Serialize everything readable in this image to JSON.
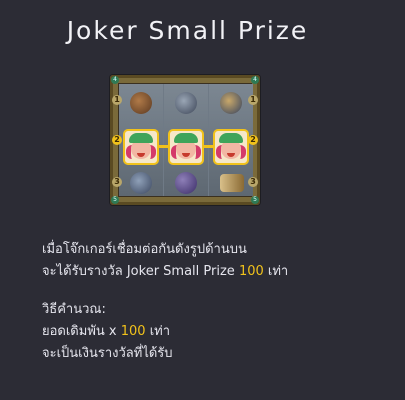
{
  "title": "Joker Small Prize",
  "description": {
    "line1": "เมื่อโจ๊กเกอร์เชื่อมต่อกันดังรูปด้านบน",
    "line2_prefix": "จะได้รับรางวัล Joker Small Prize ",
    "line2_value": "100",
    "line2_suffix": " เท่า"
  },
  "calculation": {
    "heading": "วิธีคำนวณ:",
    "line1_prefix": "ยอดเดิมพัน x ",
    "line1_value": "100",
    "line1_suffix": " เท่า",
    "line2": "จะเป็นเงินรางวัลที่ได้รับ"
  },
  "illustration": {
    "payline_badge_left": "2",
    "payline_badge_right": "2",
    "row1_badge_left": "1",
    "row1_badge_right": "1",
    "row3_badge_left": "3",
    "row3_badge_right": "3",
    "corner_tl": "4",
    "corner_tr": "4",
    "corner_bl": "5",
    "corner_br": "5",
    "icons": [
      "barrel-icon",
      "coins-icon",
      "accordion-icon",
      "joker-icon",
      "joker-icon",
      "joker-icon",
      "balloons-icon",
      "ball-icon",
      "trumpet-icon"
    ],
    "colors": {
      "payline": "#f1c21b",
      "frame": "#7a6a3a",
      "background": "#2c2c35"
    }
  }
}
